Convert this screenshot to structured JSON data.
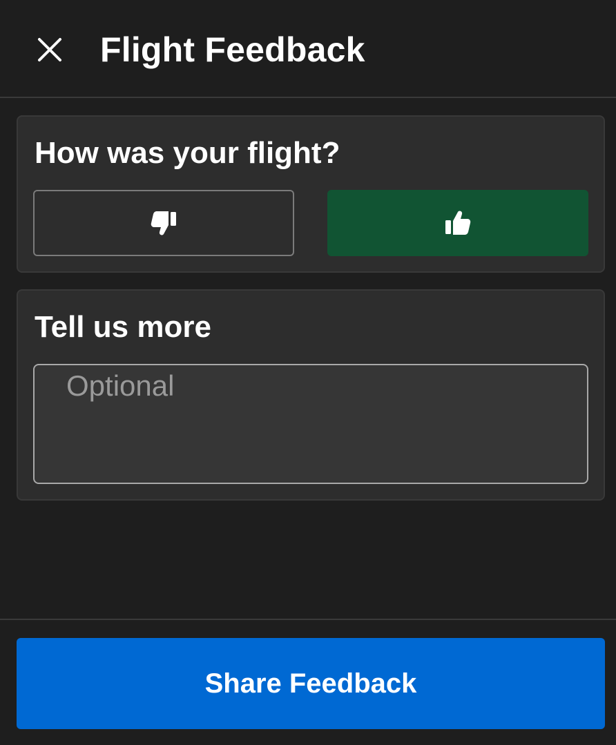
{
  "header": {
    "title": "Flight Feedback",
    "close_icon": "close-icon"
  },
  "rating": {
    "question": "How was your flight?",
    "thumbs_down_icon": "thumbs-down-icon",
    "thumbs_up_icon": "thumbs-up-icon",
    "selected": "thumbs-up"
  },
  "comments": {
    "heading": "Tell us more",
    "placeholder": "Optional",
    "value": ""
  },
  "footer": {
    "submit_label": "Share Feedback"
  },
  "colors": {
    "background": "#1e1e1e",
    "card": "#2d2d2d",
    "selected_green": "#115433",
    "primary_blue": "#0069d3"
  }
}
